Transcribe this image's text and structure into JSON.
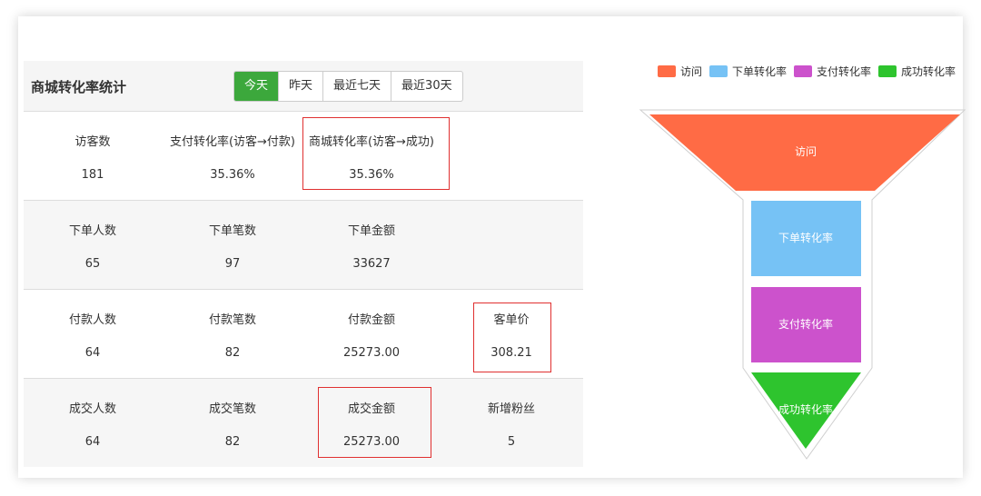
{
  "panel": {
    "title": "商城转化率统计",
    "tabs": [
      "今天",
      "昨天",
      "最近七天",
      "最近30天"
    ],
    "active_tab": "今天"
  },
  "stats": {
    "row1": {
      "visitors": {
        "label": "访客数",
        "value": "181"
      },
      "pay_rate": {
        "label": "支付转化率(访客→付款)",
        "value": "35.36%"
      },
      "mall_rate": {
        "label": "商城转化率(访客→成功)",
        "value": "35.36%"
      }
    },
    "row2": {
      "order_users": {
        "label": "下单人数",
        "value": "65"
      },
      "order_count": {
        "label": "下单笔数",
        "value": "97"
      },
      "order_amount": {
        "label": "下单金额",
        "value": "33627"
      }
    },
    "row3": {
      "pay_users": {
        "label": "付款人数",
        "value": "64"
      },
      "pay_count": {
        "label": "付款笔数",
        "value": "82"
      },
      "pay_amount": {
        "label": "付款金额",
        "value": "25273.00"
      },
      "avg_price": {
        "label": "客单价",
        "value": "308.21"
      }
    },
    "row4": {
      "deal_users": {
        "label": "成交人数",
        "value": "64"
      },
      "deal_count": {
        "label": "成交笔数",
        "value": "82"
      },
      "deal_amount": {
        "label": "成交金额",
        "value": "25273.00"
      },
      "new_fans": {
        "label": "新增粉丝",
        "value": "5"
      }
    }
  },
  "highlight_color": "#e03030",
  "chart_data": {
    "type": "funnel",
    "legend_position": "top-right",
    "stages": [
      {
        "name": "访问",
        "color": "#ff6b45"
      },
      {
        "name": "下单转化率",
        "color": "#76c2f5"
      },
      {
        "name": "支付转化率",
        "color": "#cc52cc"
      },
      {
        "name": "成功转化率",
        "color": "#2ec42e"
      }
    ]
  }
}
